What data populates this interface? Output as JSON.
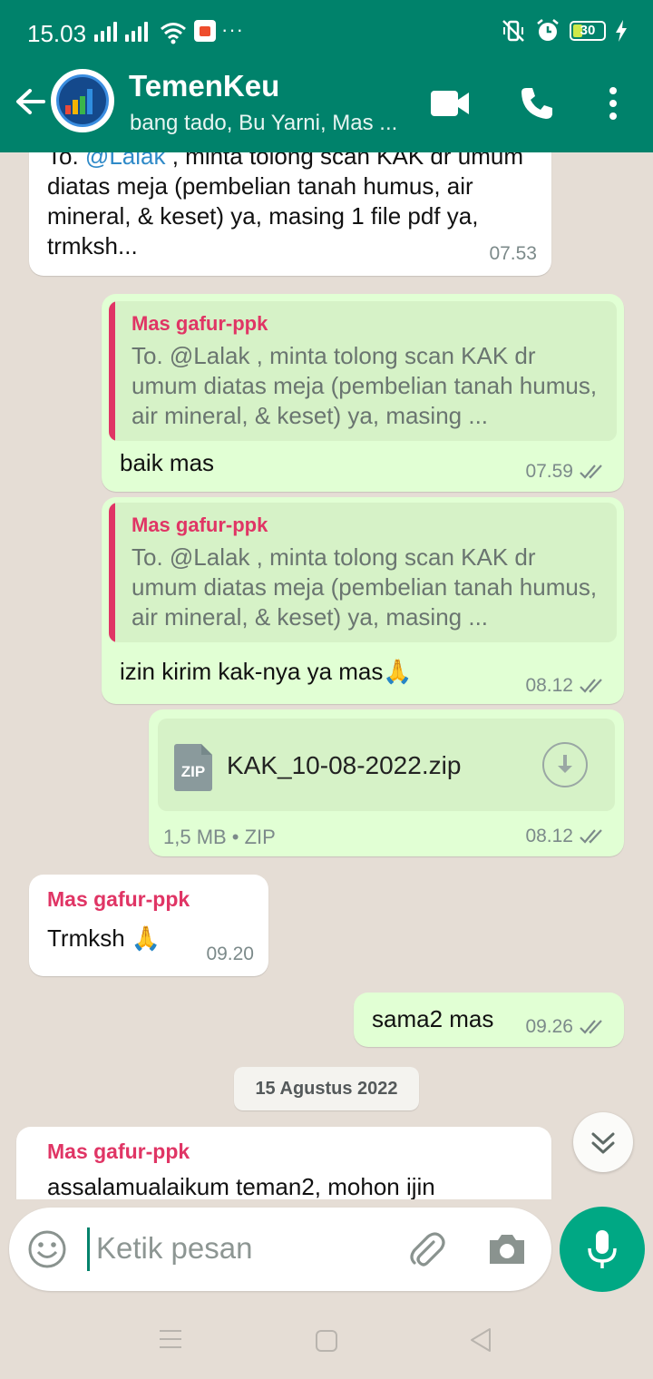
{
  "status_bar": {
    "time": "15.03",
    "dots": "···",
    "battery": "30"
  },
  "header": {
    "group_name": "TemenKeu",
    "members": "bang tado, Bu Yarni, Mas ..."
  },
  "messages": [
    {
      "direction": "incoming",
      "partial": true,
      "text_prefix": "To. ",
      "mention": "@Lalak",
      "text_rest": " , minta tolong scan KAK dr umum diatas meja (pembelian tanah humus, air mineral, & keset) ya, masing 1 file pdf ya, trmksh...",
      "time": "07.53"
    },
    {
      "direction": "outgoing",
      "quote_sender": "Mas gafur-ppk",
      "quote_text": "To. @Lalak , minta tolong scan KAK dr umum diatas meja (pembelian tanah humus, air mineral, & keset) ya, masing ...",
      "text": "baik mas",
      "time": "07.59",
      "status": "read"
    },
    {
      "direction": "outgoing",
      "quote_sender": "Mas gafur-ppk",
      "quote_text": "To. @Lalak , minta tolong scan KAK dr umum diatas meja (pembelian tanah humus, air mineral, & keset) ya, masing ...",
      "text": "izin kirim kak-nya ya mas🙏",
      "time": "08.12",
      "status": "read"
    },
    {
      "direction": "outgoing",
      "file_name": "KAK_10-08-2022.zip",
      "file_badge": "ZIP",
      "file_info": "1,5 MB • ZIP",
      "time": "08.12",
      "status": "read"
    },
    {
      "direction": "incoming",
      "sender": "Mas gafur-ppk",
      "text": "Trmksh 🙏",
      "time": "09.20"
    },
    {
      "direction": "outgoing",
      "text": "sama2 mas",
      "time": "09.26",
      "status": "read"
    },
    {
      "type": "date",
      "label": "15 Agustus 2022"
    },
    {
      "direction": "incoming",
      "partial": true,
      "sender": "Mas gafur-ppk",
      "text": "assalamualaikum teman2, mohon ijin"
    }
  ],
  "input": {
    "placeholder": "Ketik pesan"
  },
  "colors": {
    "header": "#00826b",
    "outgoing_bubble": "#e1ffd4",
    "incoming_bubble": "#ffffff",
    "sender_name": "#e03565",
    "mic_button": "#00a884"
  },
  "icons": [
    "back-arrow-icon",
    "video-call-icon",
    "phone-icon",
    "more-vert-icon",
    "emoji-icon",
    "attach-icon",
    "camera-icon",
    "mic-icon",
    "download-icon",
    "double-check-icon",
    "chevron-double-down-icon"
  ]
}
